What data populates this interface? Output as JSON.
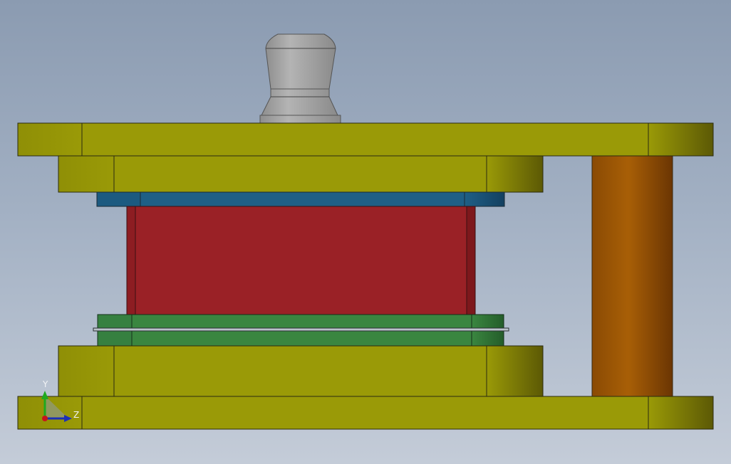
{
  "viewport": {
    "axis_labels": {
      "y": "Y",
      "z": "Z"
    }
  },
  "colors": {
    "background_top": "#8b9bb1",
    "background_bottom": "#c4ccd8",
    "die_plate": "#9a9a07",
    "die_plate_dark": "#5e5b05",
    "backing_plate": "#1f5f86",
    "punch_block": "#9a2126",
    "stripper_plate": "#3a8640",
    "guide_post": "#a25a05",
    "shank": "#a8a8a8",
    "axis_y": "#1fa91f",
    "axis_z": "#1c2fb7",
    "axis_origin": "#c8141b"
  },
  "icons": {
    "coordinate_triad": "coordinate-triad-icon"
  }
}
